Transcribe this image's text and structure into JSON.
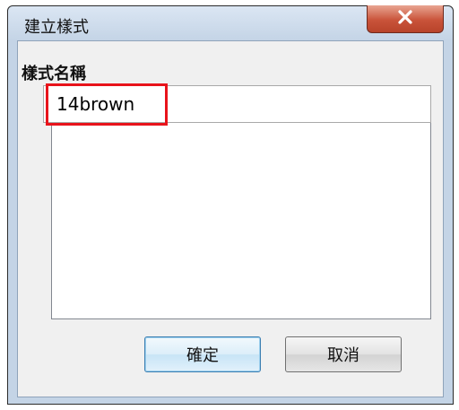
{
  "dialog": {
    "title": "建立樣式",
    "close_icon": "close-icon"
  },
  "form": {
    "label": "樣式名稱",
    "name_value": "14brown",
    "highlight_color": "#e8131b"
  },
  "buttons": {
    "ok_label": "確定",
    "cancel_label": "取消"
  }
}
